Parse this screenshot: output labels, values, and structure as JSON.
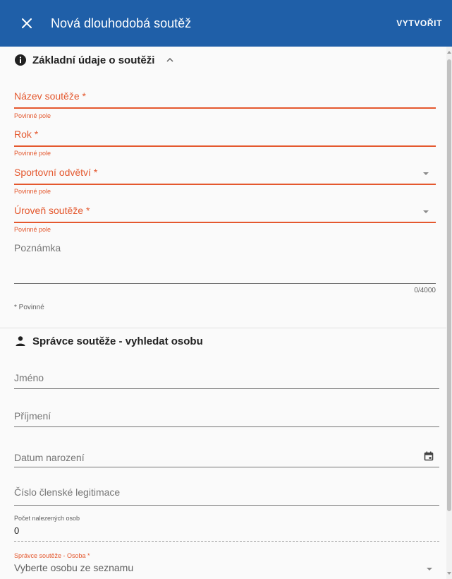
{
  "header": {
    "title": "Nová dlouhodobá soutěž",
    "create_label": "VYTVOŘIT"
  },
  "section_basic": {
    "title": "Základní údaje o soutěži",
    "fields": {
      "name": {
        "label": "Název soutěže *",
        "hint": "Povinné pole"
      },
      "year": {
        "label": "Rok *",
        "hint": "Povinné pole"
      },
      "sport": {
        "label": "Sportovní odvětví *",
        "hint": "Povinné pole"
      },
      "level": {
        "label": "Úroveň soutěže *",
        "hint": "Povinné pole"
      },
      "note": {
        "label": "Poznámka",
        "counter": "0/4000"
      }
    },
    "required_note": "* Povinné"
  },
  "section_admin": {
    "title": "Správce soutěže - vyhledat osobu",
    "fields": {
      "first_name": {
        "label": "Jméno"
      },
      "last_name": {
        "label": "Příjmení"
      },
      "birth_date": {
        "label": "Datum narození"
      },
      "member_id": {
        "label": "Číslo členské legitimace"
      }
    },
    "found_label": "Počet nalezených osob",
    "found_value": "0",
    "person_select": {
      "label": "Správce soutěže - Osoba *",
      "placeholder": "Vyberte osobu ze seznamu"
    }
  },
  "colors": {
    "header_bg": "#1f5fa8",
    "error": "#e4582e"
  },
  "icons": {
    "close": "close-icon",
    "section_basic": "info-icon",
    "section_admin": "person-icon",
    "collapse": "chevron-up-icon",
    "date": "calendar-icon",
    "dropdown": "dropdown-arrow-icon"
  }
}
